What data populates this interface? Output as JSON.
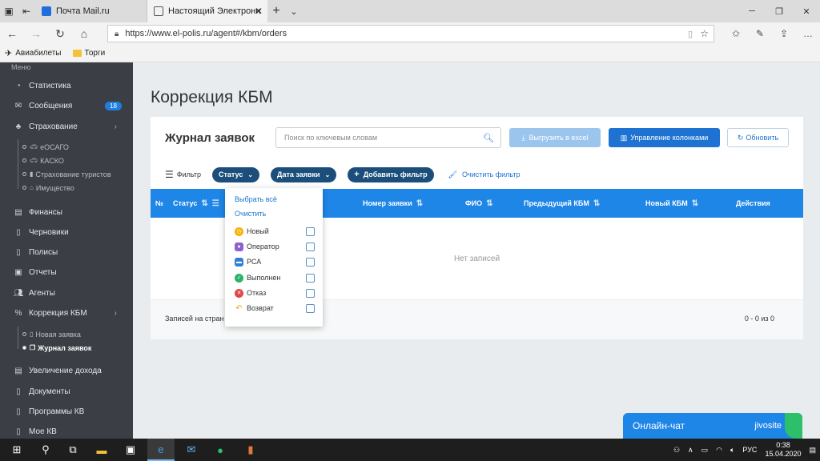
{
  "browser": {
    "tabs": [
      {
        "title": "Почта Mail.ru",
        "active": false
      },
      {
        "title": "Настоящий Электронн",
        "active": true
      }
    ],
    "url": "https://www.el-polis.ru/agent#/kbm/orders",
    "bookmarks": [
      "Авиабилеты",
      "Торги"
    ]
  },
  "sidebar": {
    "header": "Меню",
    "items": [
      {
        "label": "Статистика",
        "icon": "pie-chart-icon"
      },
      {
        "label": "Сообщения",
        "icon": "envelope-icon",
        "badge": "18"
      },
      {
        "label": "Страхование",
        "icon": "handshake-icon",
        "chevron": true
      },
      {
        "label": "Финансы",
        "icon": "money-icon"
      },
      {
        "label": "Черновики",
        "icon": "file-icon"
      },
      {
        "label": "Полисы",
        "icon": "file-icon"
      },
      {
        "label": "Отчеты",
        "icon": "clipboard-icon"
      },
      {
        "label": "Агенты",
        "icon": "users-icon"
      },
      {
        "label": "Коррекция КБМ",
        "icon": "percent-icon",
        "chevron": true
      },
      {
        "label": "Увеличение дохода",
        "icon": "money-icon"
      },
      {
        "label": "Документы",
        "icon": "file-icon"
      },
      {
        "label": "Программы КВ",
        "icon": "file-icon"
      },
      {
        "label": "Мое КВ",
        "icon": "file-icon"
      }
    ],
    "insurance_sub": [
      "еОСАГО",
      "КАСКО",
      "Страхование туристов",
      "Имущество"
    ],
    "kbm_sub": [
      "Новая заявка",
      "Журнал заявок"
    ]
  },
  "main": {
    "page_title": "Коррекция КБМ",
    "card_title": "Журнал заявок",
    "search_placeholder": "Поиск по ключевым словам",
    "btn_excel": "Выгрузить в excel",
    "btn_columns": "Управление колонками",
    "btn_refresh": "Обновить",
    "filter_label": "Фильтр",
    "filter_status": "Статус",
    "filter_date": "Дата заявки",
    "filter_add": "Добавить фильтр",
    "filter_clear": "Очистить фильтр",
    "columns": [
      "№",
      "Статус",
      "Номер заявки",
      "ФИО",
      "Предыдущий КБМ",
      "Новый КБМ",
      "Действия"
    ],
    "empty_text": "Нет записей",
    "per_page_label": "Записей на стран",
    "count_text": "0 - 0 из 0"
  },
  "status_dropdown": {
    "select_all": "Выбрать всё",
    "clear": "Очистить",
    "options": [
      {
        "label": "Новый",
        "color": "#f5b200"
      },
      {
        "label": "Оператор",
        "color": "#8e5fd1"
      },
      {
        "label": "РСА",
        "color": "#2f7fd6"
      },
      {
        "label": "Выполнен",
        "color": "#27b36a"
      },
      {
        "label": "Отказ",
        "color": "#e14545"
      },
      {
        "label": "Возврат",
        "color": "#f0a020"
      }
    ]
  },
  "chat": {
    "label": "Онлайн-чат",
    "brand": "jivosite"
  },
  "taskbar": {
    "lang": "РУС",
    "time": "0:38",
    "date": "15.04.2020"
  }
}
